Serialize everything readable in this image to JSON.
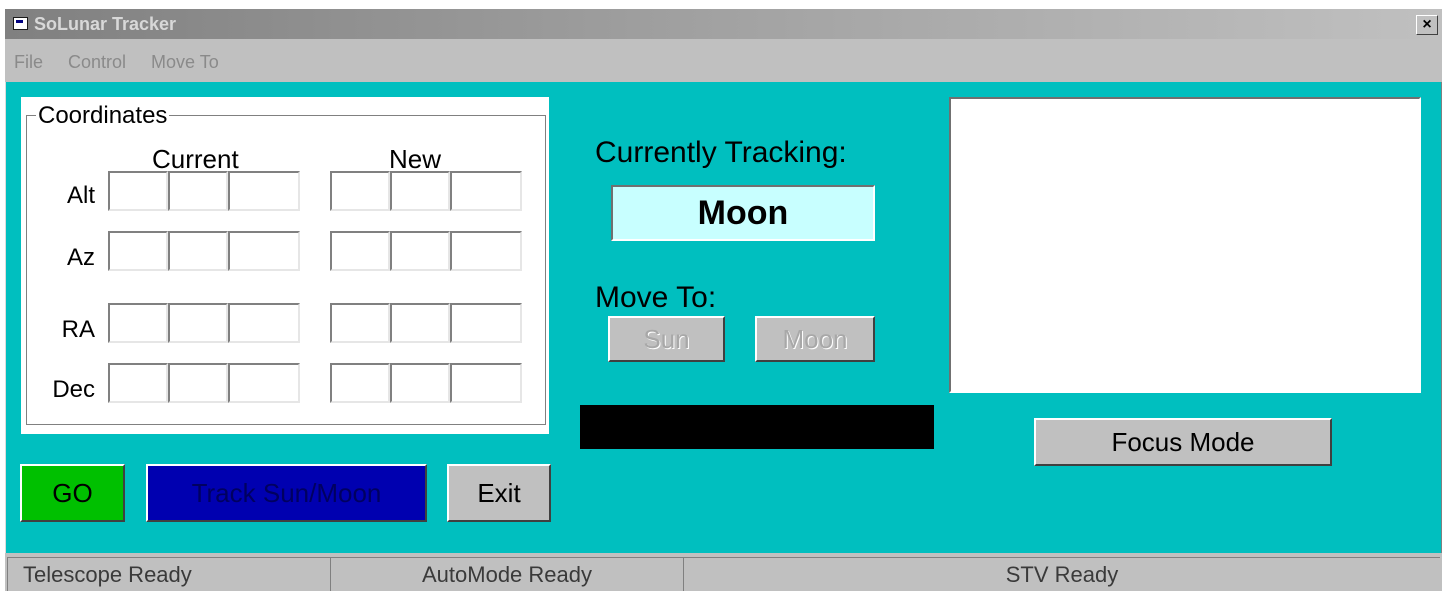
{
  "window": {
    "title": "SoLunar Tracker",
    "close_label": "×"
  },
  "menu": {
    "items": [
      "File",
      "Control",
      "Move To"
    ]
  },
  "coordinates": {
    "group_label": "Coordinates",
    "col_current": "Current",
    "col_new": "New",
    "rows": [
      "Alt",
      "Az",
      "RA",
      "Dec"
    ]
  },
  "tracking": {
    "label": "Currently Tracking:",
    "value": "Moon"
  },
  "move_to": {
    "label": "Move To:",
    "sun_label": "Sun",
    "moon_label": "Moon"
  },
  "buttons": {
    "go": "GO",
    "track": "Track Sun/Moon",
    "exit": "Exit",
    "focus_mode": "Focus Mode"
  },
  "status": {
    "telescope": "Telescope Ready",
    "automode": "AutoMode Ready",
    "stv": "STV Ready"
  },
  "colors": {
    "window_background": "#00BFBF",
    "go_button": "#00C000",
    "track_button": "#0000B0",
    "tracking_display": "#C8FFFF",
    "progress_bar": "#000000"
  }
}
